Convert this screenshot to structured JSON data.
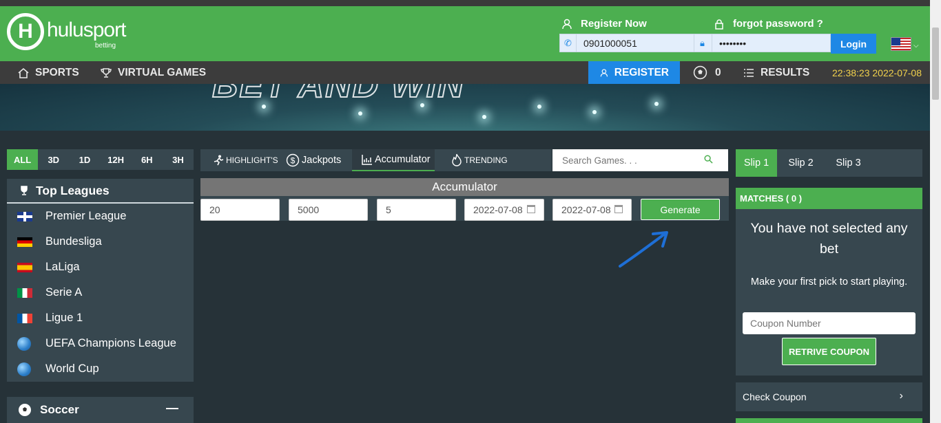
{
  "brand": {
    "name": "hulusport",
    "sub": "betting",
    "mark": "H"
  },
  "header": {
    "register_now": "Register Now",
    "forgot_password": "forgot password ?",
    "phone_value": "0901000051",
    "password_value": "••••••••",
    "login_label": "Login",
    "language_flag": "us-flag-icon"
  },
  "nav": {
    "sports": "SPORTS",
    "virtual_games": "VIRTUAL GAMES",
    "register": "REGISTER",
    "ball_count": "0",
    "results": "RESULTS",
    "clock": "22:38:23 2022-07-08"
  },
  "filters": [
    "ALL",
    "3D",
    "1D",
    "12H",
    "6H",
    "3H"
  ],
  "top_leagues": {
    "title": "Top Leagues",
    "items": [
      {
        "label": "Premier League",
        "flag": "uk"
      },
      {
        "label": "Bundesliga",
        "flag": "de"
      },
      {
        "label": "LaLiga",
        "flag": "es"
      },
      {
        "label": "Serie A",
        "flag": "it"
      },
      {
        "label": "Ligue 1",
        "flag": "fr"
      },
      {
        "label": "UEFA Champions League",
        "flag": "globe"
      },
      {
        "label": "World Cup",
        "flag": "globe"
      }
    ]
  },
  "soccer": {
    "label": "Soccer",
    "toggle": "—"
  },
  "tabs": {
    "highlights": "HIGHLIGHT'S",
    "jackpots": "Jackpots",
    "accumulator": "Accumulator",
    "trending": "TRENDING"
  },
  "search": {
    "placeholder": "Search Games. . ."
  },
  "accumulator": {
    "title": "Accumulator",
    "field1": "20",
    "field2": "5000",
    "field3": "5",
    "date_from": "2022-07-08",
    "date_to": "2022-07-08",
    "generate": "Generate"
  },
  "slip": {
    "tabs": [
      "Slip 1",
      "Slip 2",
      "Slip 3"
    ],
    "matches": "MATCHES ( 0 )",
    "no_bet": "You have not selected any bet",
    "first_pick": "Make your first pick to start playing.",
    "coupon_placeholder": "Coupon Number",
    "retrive": "RETRIVE COUPON",
    "check_coupon": "Check Coupon"
  },
  "colors": {
    "green": "#4caf50",
    "blue": "#1e88e5",
    "panel": "#37474f",
    "bg": "#263238",
    "clock": "#f2d24c"
  }
}
